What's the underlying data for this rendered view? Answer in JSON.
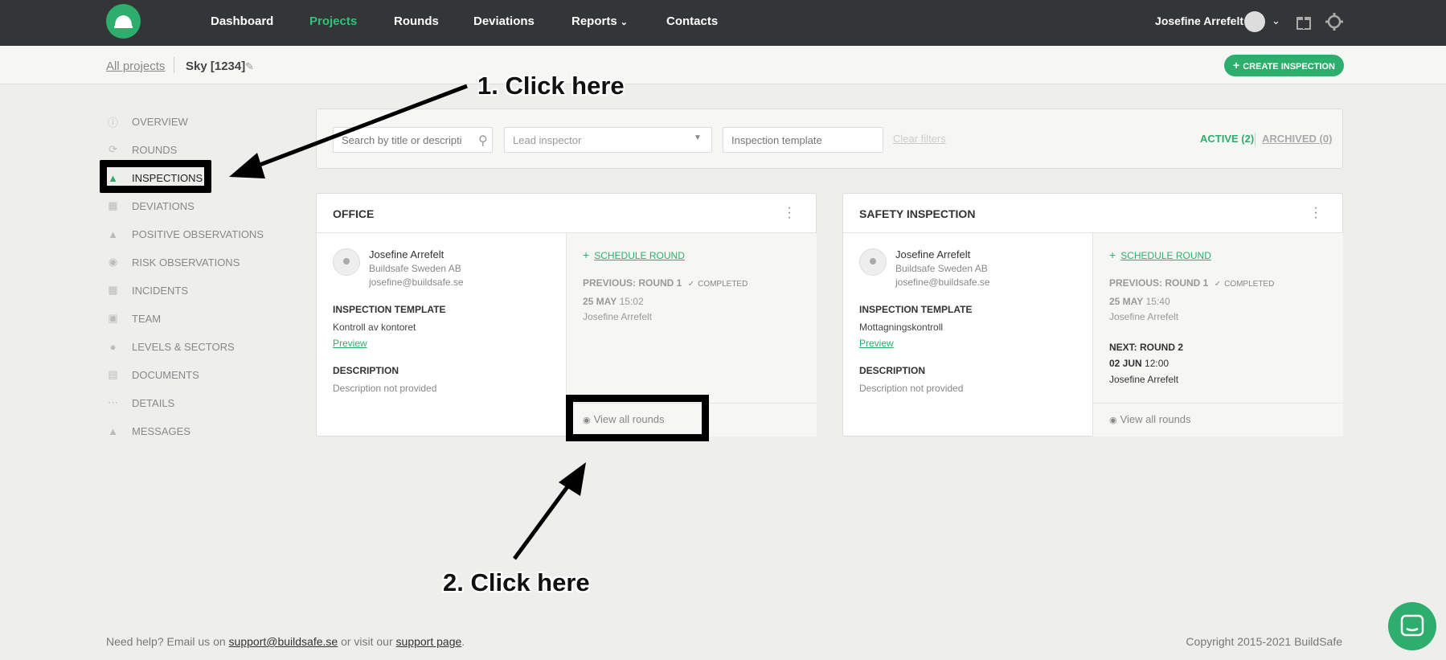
{
  "nav": {
    "items": [
      "Dashboard",
      "Projects",
      "Rounds",
      "Deviations",
      "Reports",
      "Contacts"
    ],
    "active": "Projects",
    "user_name": "Josefine Arrefelt"
  },
  "subheader": {
    "all_projects": "All projects",
    "project_name": "Sky [1234]",
    "create_button": "CREATE INSPECTION"
  },
  "sidebar": {
    "items": [
      {
        "label": "OVERVIEW",
        "icon": "info-icon"
      },
      {
        "label": "ROUNDS",
        "icon": "rounds-icon"
      },
      {
        "label": "INSPECTIONS",
        "icon": "helmet-icon"
      },
      {
        "label": "DEVIATIONS",
        "icon": "deviations-icon"
      },
      {
        "label": "POSITIVE OBSERVATIONS",
        "icon": "thumbs-up-icon"
      },
      {
        "label": "RISK OBSERVATIONS",
        "icon": "eye-icon"
      },
      {
        "label": "INCIDENTS",
        "icon": "incidents-icon"
      },
      {
        "label": "TEAM",
        "icon": "team-icon"
      },
      {
        "label": "LEVELS & SECTORS",
        "icon": "location-icon"
      },
      {
        "label": "DOCUMENTS",
        "icon": "document-icon"
      },
      {
        "label": "DETAILS",
        "icon": "more-icon"
      },
      {
        "label": "MESSAGES",
        "icon": "bell-icon"
      }
    ],
    "active": "INSPECTIONS"
  },
  "filters": {
    "search_placeholder": "Search by title or descripti",
    "lead_inspector": "Lead inspector",
    "template_placeholder": "Inspection template",
    "clear": "Clear filters",
    "active_tab": "ACTIVE (2)",
    "archived_tab": "ARCHIVED (0)"
  },
  "cards": [
    {
      "title": "OFFICE",
      "inspector": {
        "name": "Josefine Arrefelt",
        "org": "Buildsafe Sweden AB",
        "email": "josefine@buildsafe.se"
      },
      "template_label": "INSPECTION TEMPLATE",
      "template_value": "Kontroll av kontoret",
      "preview": "Preview",
      "description_label": "DESCRIPTION",
      "description_value": "Description not provided",
      "schedule": "SCHEDULE ROUND",
      "previous": "PREVIOUS: ROUND 1",
      "completed": "COMPLETED",
      "prev_date": "25 MAY",
      "prev_time": "15:02",
      "prev_person": "Josefine Arrefelt",
      "view_all": "View all rounds"
    },
    {
      "title": "SAFETY INSPECTION",
      "inspector": {
        "name": "Josefine Arrefelt",
        "org": "Buildsafe Sweden AB",
        "email": "josefine@buildsafe.se"
      },
      "template_label": "INSPECTION TEMPLATE",
      "template_value": "Mottagningskontroll",
      "preview": "Preview",
      "description_label": "DESCRIPTION",
      "description_value": "Description not provided",
      "schedule": "SCHEDULE ROUND",
      "previous": "PREVIOUS: ROUND 1",
      "completed": "COMPLETED",
      "prev_date": "25 MAY",
      "prev_time": "15:40",
      "prev_person": "Josefine Arrefelt",
      "next": "NEXT: ROUND 2",
      "next_date": "02 JUN",
      "next_time": "12:00",
      "next_person": "Josefine Arrefelt",
      "view_all": "View all rounds"
    }
  ],
  "annotations": {
    "step1": "1. Click here",
    "step2": "2. Click here"
  },
  "footer": {
    "help_prefix": "Need help? Email us on",
    "email": "support@buildsafe.se",
    "middle": "or visit our",
    "support_link": "support page",
    "suffix": ".",
    "copyright": "Copyright 2015-2021 BuildSafe"
  },
  "colors": {
    "accent": "#2eae6d",
    "topbar": "#333537",
    "background": "#eeefec"
  }
}
